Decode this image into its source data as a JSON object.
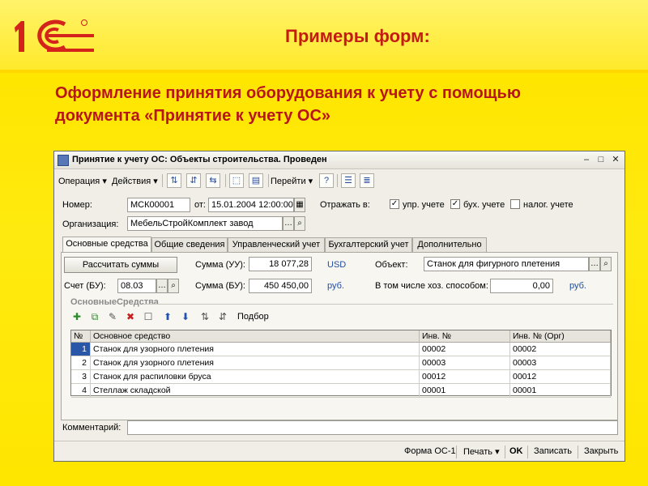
{
  "slide": {
    "title": "Примеры форм:",
    "subtitle_line1": "Оформление принятия оборудования к учету с помощью",
    "subtitle_line2": "документа «Принятие к учету ОС»",
    "logo_text": "1С",
    "colors": {
      "background": "#ffe600",
      "title": "#c41c12",
      "logo": "#d3231b"
    }
  },
  "window": {
    "title": "Принятие к учету ОС: Объекты строительства. Проведен",
    "controls": [
      "minimize-icon",
      "maximize-icon",
      "close-icon"
    ],
    "menu": {
      "operation": "Операция ▾",
      "actions": "Действия ▾",
      "goto": "Перейти ▾",
      "help": "?"
    },
    "header": {
      "number_label": "Номер:",
      "number_value": "МСК00001",
      "date_label": "от:",
      "date_value": "15.01.2004 12:00:00",
      "reflect_label": "Отражать в:",
      "mgmt_label": "упр. учете",
      "mgmt_checked": true,
      "acct_label": "бух. учете",
      "acct_checked": true,
      "tax_label": "налог. учете",
      "tax_checked": false,
      "org_label": "Организация:",
      "org_value": "МебельСтройКомплект завод"
    },
    "tabs": [
      {
        "label": "Основные средства",
        "active": true
      },
      {
        "label": "Общие сведения",
        "active": false
      },
      {
        "label": "Управленческий учет",
        "active": false
      },
      {
        "label": "Бухгалтерский учет",
        "active": false
      },
      {
        "label": "Дополнительно",
        "active": false
      }
    ],
    "main": {
      "calc_button": "Рассчитать суммы",
      "sum_mgmt_label": "Сумма (УУ):",
      "sum_mgmt_value": "18 077,28",
      "currency_mgmt": "USD",
      "object_label": "Объект:",
      "object_value": "Станок для фигурного плетения",
      "account_label": "Счет (БУ):",
      "account_value": "08.03",
      "sum_acct_label": "Сумма (БУ):",
      "sum_acct_value": "450 450,00",
      "currency_acct": "руб.",
      "incl_label": "В том числе хоз. способом:",
      "incl_value": "0,00",
      "currency_incl": "руб.",
      "section_title": "ОсновныеСредства",
      "pick_label": "Подбор"
    },
    "table": {
      "columns": [
        "№",
        "Основное средство",
        "Инв. №",
        "Инв. № (Орг)"
      ],
      "rows": [
        [
          "1",
          "Станок для узорного плетения",
          "00002",
          "00002"
        ],
        [
          "2",
          "Станок для узорного плетения",
          "00003",
          "00003"
        ],
        [
          "3",
          "Станок для распиловки бруса",
          "00012",
          "00012"
        ],
        [
          "4",
          "Стеллаж складской",
          "00001",
          "00001"
        ]
      ]
    },
    "comment_label": "Комментарий:",
    "comment_value": "",
    "footer": {
      "form": "Форма ОС-1",
      "print": "Печать ▾",
      "ok": "OK",
      "save": "Записать",
      "close": "Закрыть"
    }
  }
}
